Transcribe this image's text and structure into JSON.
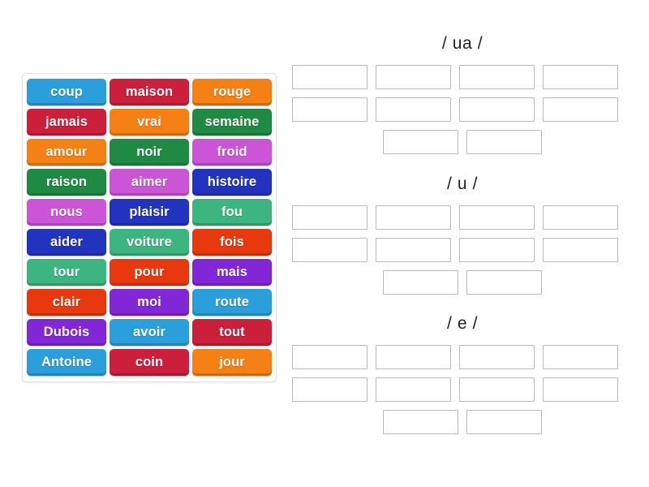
{
  "word_bank": {
    "name": "word-bank",
    "rows": [
      [
        {
          "label": "coup",
          "color": "#2a9fdc"
        },
        {
          "label": "maison",
          "color": "#cc1f3c"
        },
        {
          "label": "rouge",
          "color": "#f58014"
        }
      ],
      [
        {
          "label": "jamais",
          "color": "#cc1f3c"
        },
        {
          "label": "vrai",
          "color": "#f58014"
        },
        {
          "label": "semaine",
          "color": "#1f8a43"
        }
      ],
      [
        {
          "label": "amour",
          "color": "#f58014"
        },
        {
          "label": "noir",
          "color": "#1f8a43"
        },
        {
          "label": "froid",
          "color": "#cc54d6"
        }
      ],
      [
        {
          "label": "raison",
          "color": "#1f8a43"
        },
        {
          "label": "aimer",
          "color": "#cc54d6"
        },
        {
          "label": "histoire",
          "color": "#2233c0"
        }
      ],
      [
        {
          "label": "nous",
          "color": "#cc54d6"
        },
        {
          "label": "plaisir",
          "color": "#2233c0"
        },
        {
          "label": "fou",
          "color": "#3cb580"
        }
      ],
      [
        {
          "label": "aider",
          "color": "#2233c0"
        },
        {
          "label": "voiture",
          "color": "#3cb580"
        },
        {
          "label": "fois",
          "color": "#e8380d"
        }
      ],
      [
        {
          "label": "tour",
          "color": "#3cb580"
        },
        {
          "label": "pour",
          "color": "#e8380d"
        },
        {
          "label": "mais",
          "color": "#8227d8"
        }
      ],
      [
        {
          "label": "clair",
          "color": "#e8380d"
        },
        {
          "label": "moi",
          "color": "#8227d8"
        },
        {
          "label": "route",
          "color": "#2a9fdc"
        }
      ],
      [
        {
          "label": "Dubois",
          "color": "#8227d8"
        },
        {
          "label": "avoir",
          "color": "#2a9fdc"
        },
        {
          "label": "tout",
          "color": "#cc1f3c"
        }
      ],
      [
        {
          "label": "Antoine",
          "color": "#2a9fdc"
        },
        {
          "label": "coin",
          "color": "#cc1f3c"
        },
        {
          "label": "jour",
          "color": "#f58014"
        }
      ]
    ]
  },
  "zones": [
    {
      "title": "/ ua /",
      "slots": [
        "",
        "",
        "",
        "",
        "",
        "",
        "",
        "",
        "",
        ""
      ],
      "rows": [
        4,
        4,
        2
      ]
    },
    {
      "title": "/ u /",
      "slots": [
        "",
        "",
        "",
        "",
        "",
        "",
        "",
        "",
        "",
        ""
      ],
      "rows": [
        4,
        4,
        2
      ]
    },
    {
      "title": "/ e /",
      "slots": [
        "",
        "",
        "",
        "",
        "",
        "",
        "",
        "",
        "",
        ""
      ],
      "rows": [
        4,
        4,
        2
      ]
    }
  ]
}
